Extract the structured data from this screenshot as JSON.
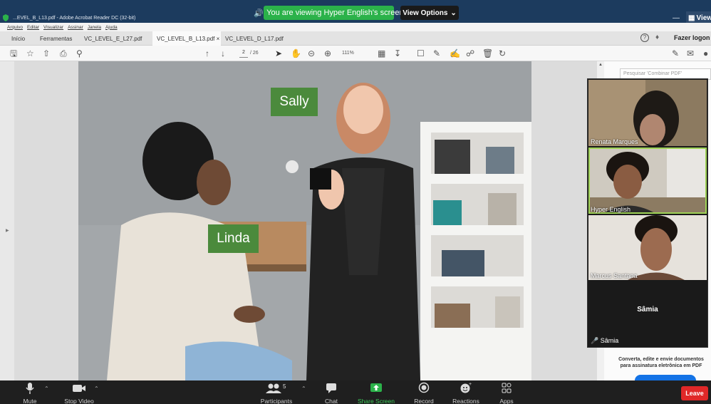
{
  "window": {
    "title": "...EVEL_B_L13.pdf - Adobe Acrobat Reader DC (32-bit)",
    "view_label": "View"
  },
  "share_banner": {
    "text": "You are viewing Hyper English's screen",
    "view_options": "View Options"
  },
  "menu": [
    "Arquivo",
    "Editar",
    "Visualizar",
    "Assinar",
    "Janela",
    "Ajuda"
  ],
  "tabs": [
    {
      "label": "Início"
    },
    {
      "label": "Ferramentas"
    },
    {
      "label": "VC_LEVEL_E_L27.pdf"
    },
    {
      "label": "VC_LEVEL_B_L13.pdf ×"
    },
    {
      "label": "VC_LEVEL_D_L17.pdf"
    }
  ],
  "header_right": {
    "login": "Fazer logon",
    "help": "?"
  },
  "toolbar": {
    "page_current": "2",
    "page_total": "/ 26",
    "zoom": "111%"
  },
  "document": {
    "labels": {
      "sally": "Sally",
      "linda": "Linda"
    }
  },
  "right_pane": {
    "search_placeholder": "Pesquisar 'Combinar PDF'",
    "promo_text": "Converta, edite e envie documentos para assinatura eletrônica em PDF"
  },
  "participants_panel": [
    {
      "name": "Renata Marques"
    },
    {
      "name": "Hyper English"
    },
    {
      "name": "Marcus Santana"
    },
    {
      "name": "Sâmia"
    }
  ],
  "zoom_bar": {
    "mute": "Mute",
    "stop_video": "Stop Video",
    "participants": "Participants",
    "participants_count": "5",
    "chat": "Chat",
    "share_screen": "Share Screen",
    "record": "Record",
    "reactions": "Reactions",
    "apps": "Apps",
    "leave": "Leave"
  },
  "colors": {
    "title_bar": "#1c3b5e",
    "share_green": "#2bb24a",
    "name_tag_green": "#4b8a3c",
    "leave_red": "#e02828",
    "active_speaker": "#9fd356"
  }
}
